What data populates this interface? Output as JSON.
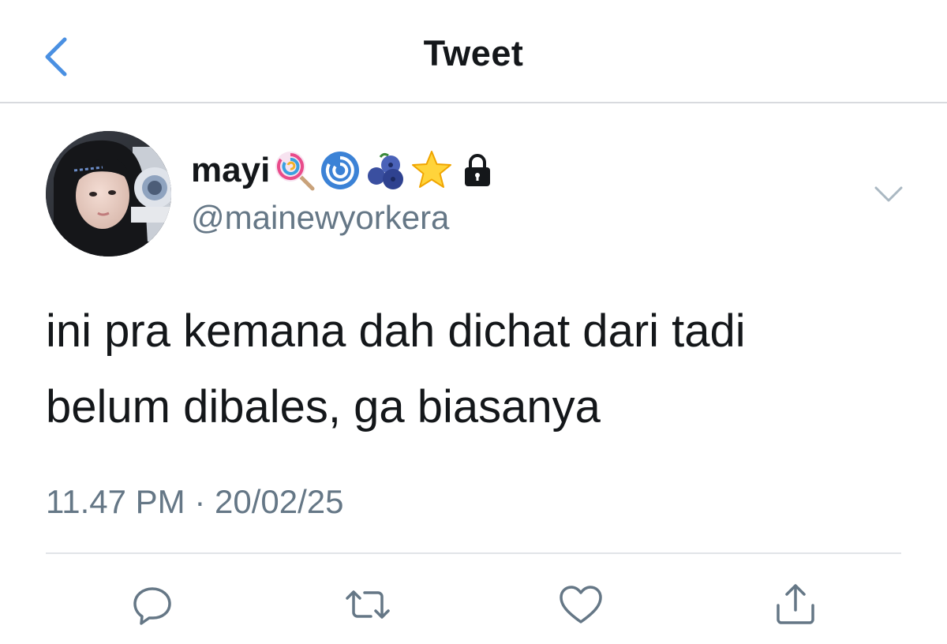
{
  "header": {
    "title": "Tweet",
    "back_icon": "chevron-left-icon"
  },
  "tweet": {
    "author": {
      "display_name": "mayi",
      "name_emojis": [
        "lollipop",
        "cyclone",
        "blueberries",
        "star",
        "lock"
      ],
      "handle": "@mainewyorkera"
    },
    "text_lines": [
      "ini pra kemana dah dichat dari tadi",
      "belum dibales, ga biasanya"
    ],
    "timestamp": "11.47 PM · 20/02/25",
    "actions": [
      "reply-icon",
      "retweet-icon",
      "like-icon",
      "share-icon"
    ]
  },
  "colors": {
    "accent": "#4a90e2",
    "text": "#14171a",
    "secondary": "#657786",
    "divider": "#e1e4e8"
  }
}
